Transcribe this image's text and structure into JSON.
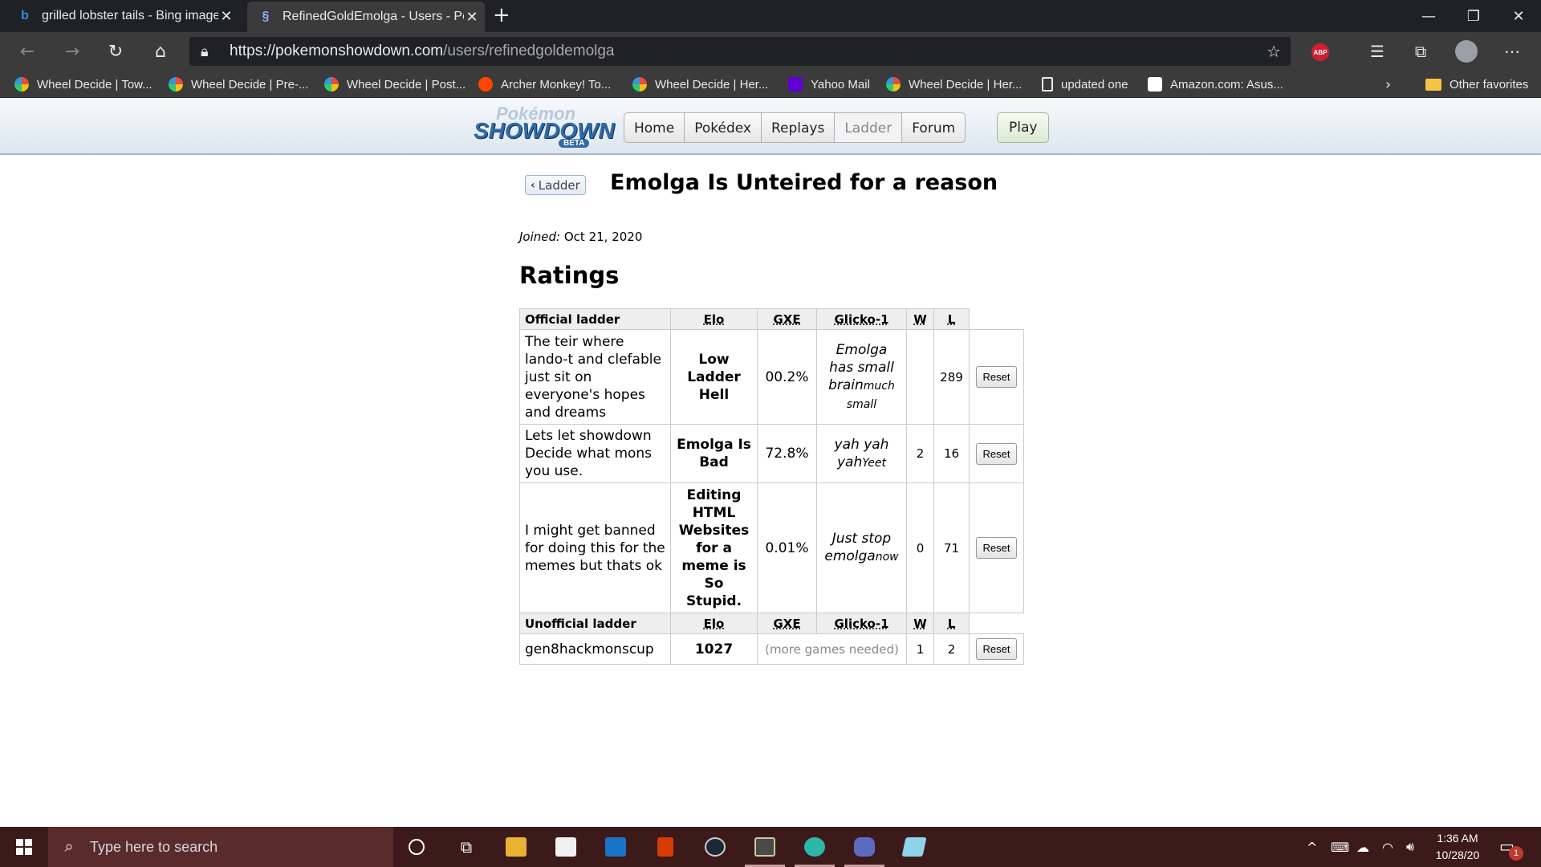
{
  "browser": {
    "tabs": [
      {
        "title": "grilled lobster tails - Bing images",
        "icon": "bing-icon"
      },
      {
        "title": "RefinedGoldEmolga - Users - Pok",
        "icon": "showdown-icon"
      }
    ],
    "url_host": "https://pokemonshowdown.com",
    "url_path": "/users/refinedgoldemolga",
    "bookmarks": [
      {
        "label": "Wheel Decide | Tow...",
        "icon": "wheel"
      },
      {
        "label": "Wheel Decide | Pre-...",
        "icon": "wheel"
      },
      {
        "label": "Wheel Decide | Post...",
        "icon": "wheel"
      },
      {
        "label": "Archer Monkey! To...",
        "icon": "reddit"
      },
      {
        "label": "Wheel Decide | Her...",
        "icon": "wheel"
      },
      {
        "label": "Yahoo Mail",
        "icon": "yahoo"
      },
      {
        "label": "Wheel Decide | Her...",
        "icon": "wheel"
      },
      {
        "label": "updated one",
        "icon": "page"
      },
      {
        "label": "Amazon.com: Asus...",
        "icon": "amazon"
      }
    ],
    "other_favorites": "Other favorites",
    "abp_label": "ABP"
  },
  "site": {
    "logo_line1": "Pokémon",
    "logo_line2": "SHOWDOWN",
    "logo_line3": "BETA",
    "nav": [
      "Home",
      "Pokédex",
      "Replays",
      "Ladder",
      "Forum"
    ],
    "play": "Play"
  },
  "profile": {
    "back_label": "Ladder",
    "username": "Emolga Is Unteired for a reason",
    "joined_label": "Joined:",
    "joined_date": "Oct 21, 2020",
    "ratings_heading": "Ratings"
  },
  "ratings": {
    "official_header": [
      "Official ladder",
      "Elo",
      "GXE",
      "Glicko-1",
      "W",
      "L"
    ],
    "official_rows": [
      {
        "format": "The teir where lando-t and clefable just sit on everyone's hopes and dreams",
        "elo": "Low Ladder Hell",
        "gxe": "00.2%",
        "glicko": "Emolga has small brain",
        "glicko_small": "much small",
        "w": "",
        "l": "289",
        "reset": "Reset"
      },
      {
        "format": "Lets let showdown Decide what mons you use.",
        "elo": "Emolga Is Bad",
        "gxe": "72.8%",
        "glicko": "yah yah yah",
        "glicko_small": "Yeet",
        "w": "2",
        "l": "16",
        "reset": "Reset"
      },
      {
        "format": "I might get banned for doing this for the memes but thats ok",
        "elo": "Editing HTML Websites for a meme is So Stupid.",
        "gxe": "0.01%",
        "glicko": "Just stop emolga",
        "glicko_small": "now",
        "w": "0",
        "l": "71",
        "reset": "Reset"
      }
    ],
    "unofficial_header": [
      "Unofficial ladder",
      "Elo",
      "GXE",
      "Glicko-1",
      "W",
      "L"
    ],
    "unofficial_rows": [
      {
        "format": "gen8hackmonscup",
        "elo": "1027",
        "gxe_glicko": "(more games needed)",
        "w": "1",
        "l": "2",
        "reset": "Reset"
      }
    ]
  },
  "taskbar": {
    "search_placeholder": "Type here to search",
    "time": "1:36 AM",
    "date": "10/28/20",
    "notification_count": "1"
  }
}
